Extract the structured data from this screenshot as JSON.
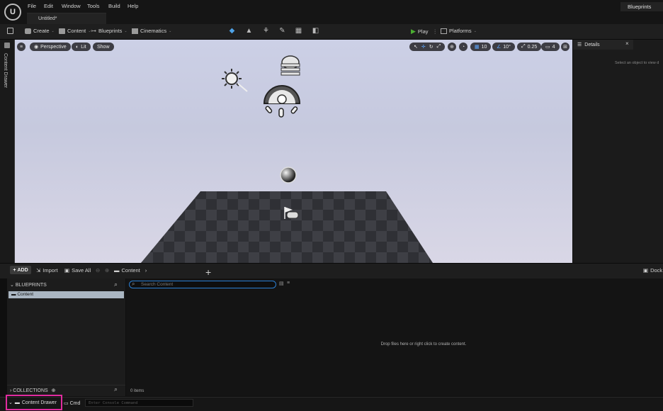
{
  "app": {
    "logo_text": "U"
  },
  "menu": [
    "File",
    "Edit",
    "Window",
    "Tools",
    "Build",
    "Help"
  ],
  "tab": {
    "label": "Untitled*"
  },
  "top_right_tag": "Blueprints",
  "toolbar": {
    "create": "Create",
    "content": "Content",
    "blueprints": "Blueprints",
    "cinematics": "Cinematics",
    "play": "Play",
    "platforms": "Platforms"
  },
  "side_tab": "Content Drawer",
  "viewport": {
    "perspective": "Perspective",
    "lit": "Lit",
    "show": "Show",
    "grid_snap": "10",
    "rotation_snap": "10°",
    "scale_snap": "0.25",
    "camera_speed": "4"
  },
  "details": {
    "tab_label": "Details",
    "close_glyph": "×",
    "empty_message": "Select an object to view d"
  },
  "content_browser": {
    "add": "ADD",
    "import": "Import",
    "save_all": "Save All",
    "breadcrumb": "Content",
    "dock": "Dock",
    "blueprints_header": "BLUEPRINTS",
    "content_folder": "Content",
    "collections": "COLLECTIONS",
    "search_placeholder": "Search Content",
    "drop_message": "Drop files here or right click to create content.",
    "items_count": "0 items"
  },
  "statusbar": {
    "content_drawer": "Content Drawer",
    "cmd": "Cmd",
    "console_placeholder": "Enter Console Command"
  },
  "colors": {
    "accent_blue": "#2b7fd3",
    "play_green": "#4caf32",
    "highlight_pink": "#e02c9f"
  }
}
